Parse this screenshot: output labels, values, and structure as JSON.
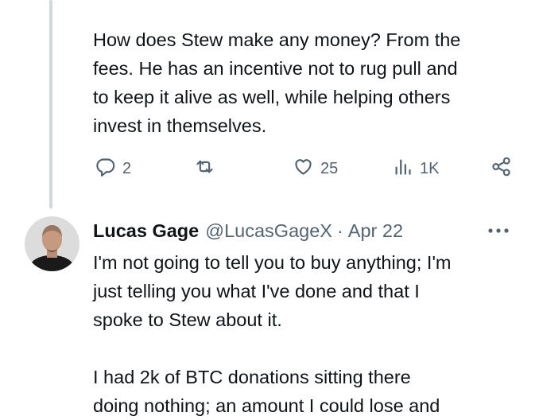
{
  "thread": {
    "prev_tweet": {
      "text": "How does Stew make any money? From the\nfees. He has an incentive not to rug pull and\nto keep it alive as well, while helping others\ninvest in themselves.",
      "actions": {
        "replies": "2",
        "retweets": "",
        "likes": "25",
        "views": "1K"
      },
      "icons": [
        "reply-icon",
        "retweet-icon",
        "like-icon",
        "views-icon",
        "share-icon"
      ]
    },
    "reply_tweet": {
      "author_name": "Lucas Gage",
      "handle": "@LucasGageX",
      "separator": "·",
      "date": "Apr 22",
      "text": "I'm not going to tell you to buy anything; I'm\njust telling you what I've done and that I\nspoke to Stew about it.\n\nI had 2k of BTC donations sitting there\ndoing nothing; an amount I could lose and"
    }
  },
  "colors": {
    "text": "#0f1419",
    "muted": "#536471",
    "thread_line": "#cfd9de",
    "background": "#ffffff"
  }
}
